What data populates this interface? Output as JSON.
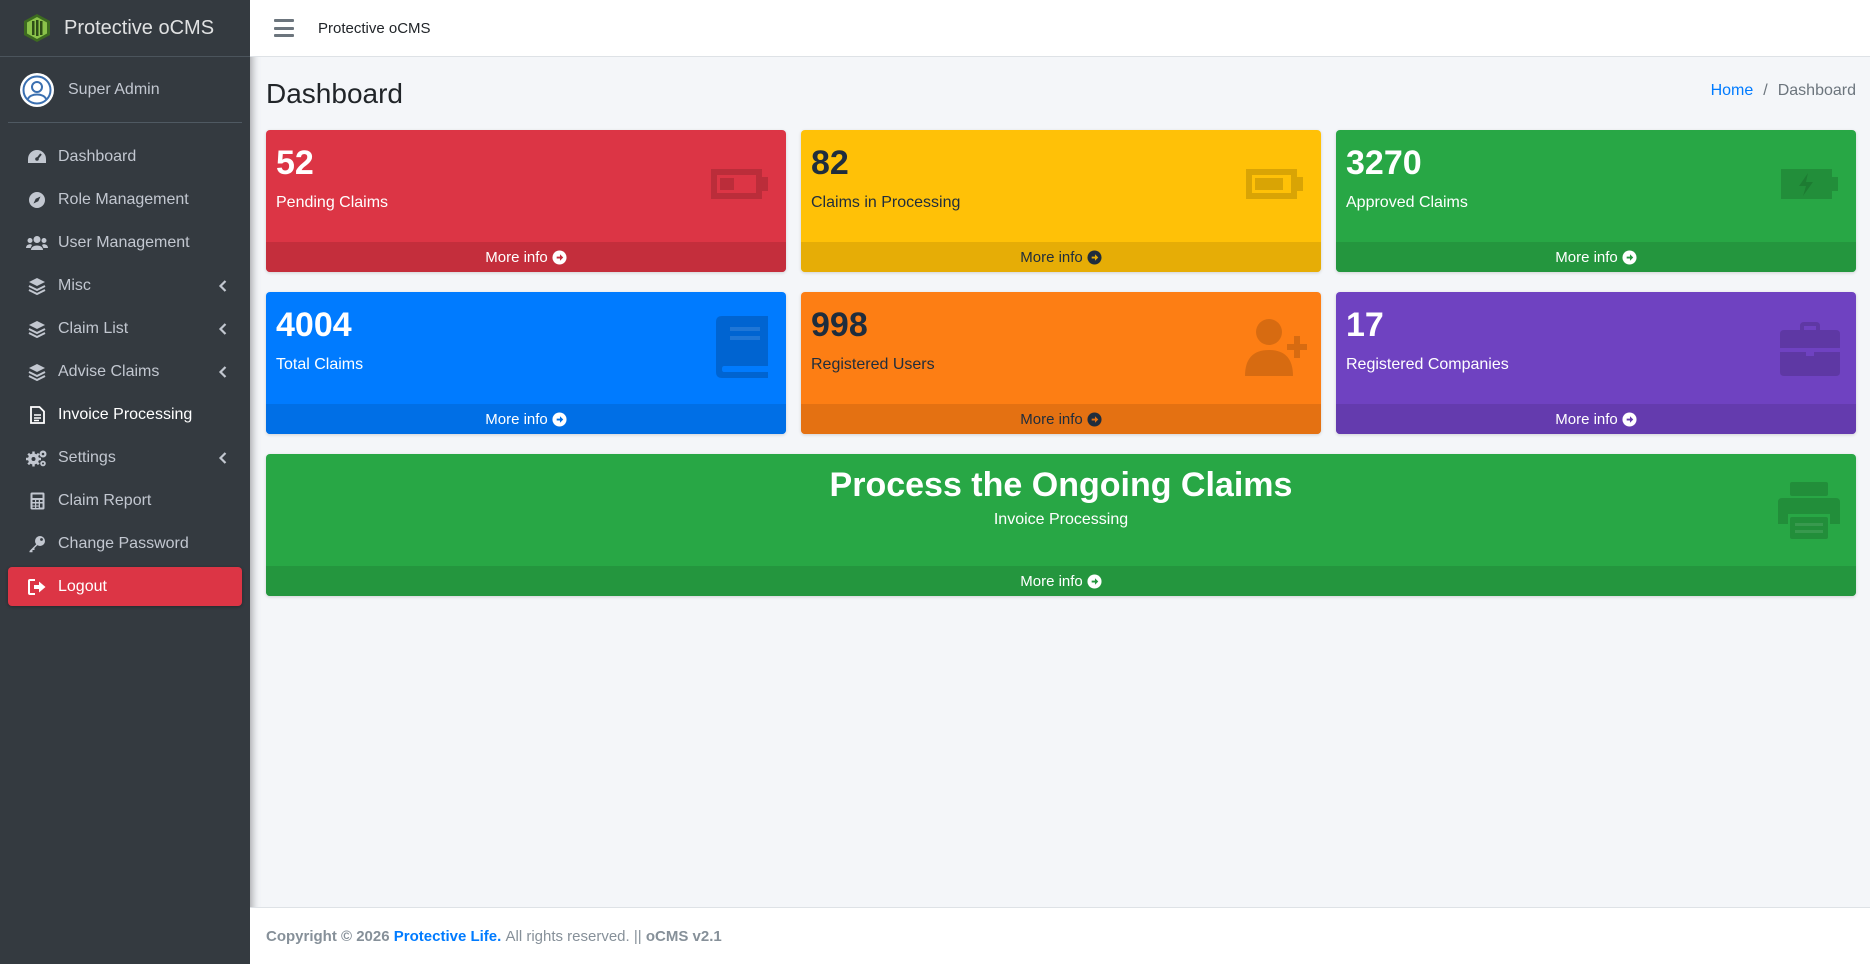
{
  "brand": {
    "name": "Protective oCMS"
  },
  "user": {
    "name": "Super Admin"
  },
  "nav": {
    "items": [
      {
        "label": "Dashboard"
      },
      {
        "label": "Role Management"
      },
      {
        "label": "User Management"
      },
      {
        "label": "Misc"
      },
      {
        "label": "Claim List"
      },
      {
        "label": "Advise Claims"
      },
      {
        "label": "Invoice Processing"
      },
      {
        "label": "Settings"
      },
      {
        "label": "Claim Report"
      },
      {
        "label": "Change Password"
      },
      {
        "label": "Logout"
      }
    ]
  },
  "topbar": {
    "title": "Protective oCMS"
  },
  "header": {
    "title": "Dashboard"
  },
  "breadcrumb": {
    "home": "Home",
    "separator": "/",
    "current": "Dashboard"
  },
  "cards": [
    {
      "value": "52",
      "label": "Pending Claims",
      "more": "More info",
      "color": "#dc3545",
      "icon": "battery-quarter-icon"
    },
    {
      "value": "82",
      "label": "Claims in Processing",
      "more": "More info",
      "color": "#ffc107",
      "icon": "battery-three-quarters-icon"
    },
    {
      "value": "3270",
      "label": "Approved Claims",
      "more": "More info",
      "color": "#28a745",
      "icon": "battery-charging-icon"
    },
    {
      "value": "4004",
      "label": "Total Claims",
      "more": "More info",
      "color": "#007bff",
      "icon": "book-icon"
    },
    {
      "value": "998",
      "label": "Registered Users",
      "more": "More info",
      "color": "#fd7e14",
      "icon": "user-plus-icon"
    },
    {
      "value": "17",
      "label": "Registered Companies",
      "more": "More info",
      "color": "#6f42c1",
      "icon": "briefcase-icon"
    }
  ],
  "process": {
    "title": "Process the Ongoing Claims",
    "subtitle": "Invoice Processing",
    "more": "More info",
    "icon": "printer-icon"
  },
  "footer": {
    "copyright": "Copyright © 2026",
    "company": "Protective Life.",
    "rights": "All rights reserved.",
    "divider": "||",
    "version": "oCMS v2.1"
  }
}
